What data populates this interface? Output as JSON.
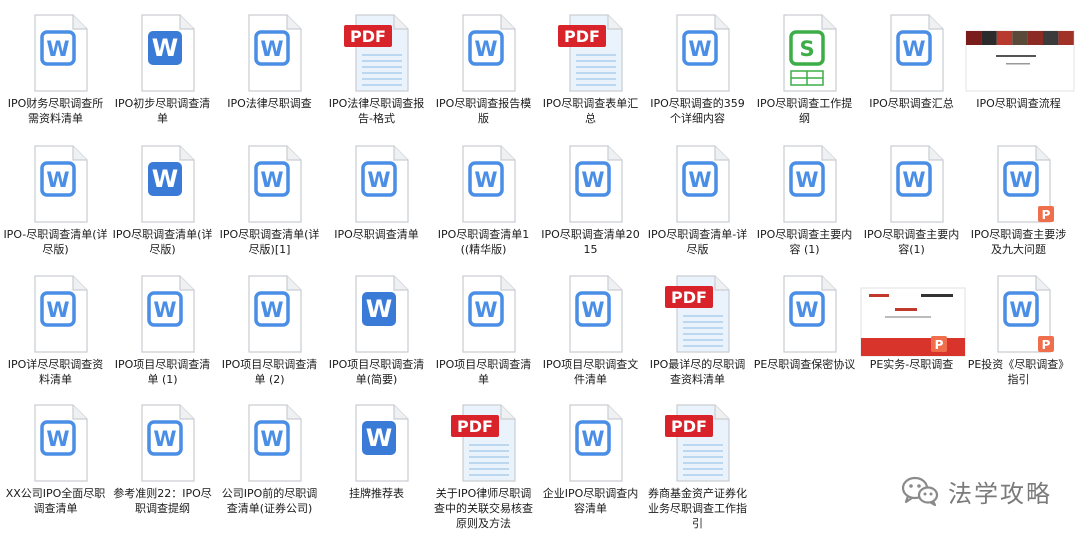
{
  "files": [
    {
      "name": "IPO财务尽职调查所需资料清单",
      "icon": "word-doc-icon"
    },
    {
      "name": "IPO初步尽职调查清单",
      "icon": "word-doc-icon"
    },
    {
      "name": "IPO法律尽职调查",
      "icon": "word-doc-icon"
    },
    {
      "name": "IPO法律尽职调查报告-格式",
      "icon": "pdf-doc-icon"
    },
    {
      "name": "IPO尽职调查报告模版",
      "icon": "word-doc-icon"
    },
    {
      "name": "IPO尽职调查表单汇总",
      "icon": "pdf-doc-icon"
    },
    {
      "name": "IPO尽职调查的359个详细内容",
      "icon": "word-doc-icon"
    },
    {
      "name": "IPO尽职调查工作提纲",
      "icon": "spreadsheet-doc-icon"
    },
    {
      "name": "IPO尽职调查汇总",
      "icon": "word-doc-icon"
    },
    {
      "name": "IPO尽职调查流程",
      "icon": "image-thumbnail-icon"
    },
    {
      "name": "IPO-尽职调查清单(详尽版)",
      "icon": "word-doc-icon"
    },
    {
      "name": "IPO尽职调查清单(详尽版)",
      "icon": "word-doc-icon"
    },
    {
      "name": "IPO尽职调查清单(详尽版)[1]",
      "icon": "word-doc-icon"
    },
    {
      "name": "IPO尽职调查清单",
      "icon": "word-doc-icon"
    },
    {
      "name": "IPO尽职调查清单1((精华版)",
      "icon": "word-doc-icon"
    },
    {
      "name": "IPO尽职调查清单2015",
      "icon": "word-doc-icon"
    },
    {
      "name": "IPO尽职调查清单-详尽版",
      "icon": "word-doc-icon"
    },
    {
      "name": "IPO尽职调查主要内容 (1)",
      "icon": "word-doc-icon"
    },
    {
      "name": "IPO尽职调查主要内容(1)",
      "icon": "word-doc-icon"
    },
    {
      "name": "IPO尽职调查主要涉及九大问题",
      "icon": "word-doc-icon",
      "badge": "P"
    },
    {
      "name": "IPO详尽尽职调查资料清单",
      "icon": "word-doc-icon"
    },
    {
      "name": "IPO项目尽职调查清单 (1)",
      "icon": "word-doc-icon"
    },
    {
      "name": "IPO项目尽职调查清单 (2)",
      "icon": "word-doc-icon"
    },
    {
      "name": "IPO项目尽职调查清单(简要)",
      "icon": "word-doc-icon"
    },
    {
      "name": "IPO项目尽职调查清单",
      "icon": "word-doc-icon"
    },
    {
      "name": "IPO项目尽职调查文件清单",
      "icon": "word-doc-icon"
    },
    {
      "name": "IPO最详尽的尽职调查资料清单",
      "icon": "pdf-doc-icon"
    },
    {
      "name": "PE尽职调查保密协议",
      "icon": "word-doc-icon"
    },
    {
      "name": "PE实务-尽职调查",
      "icon": "slides-thumbnail-icon",
      "badge": "P"
    },
    {
      "name": "PE投资《尽职调查》指引",
      "icon": "word-doc-icon",
      "badge": "P"
    },
    {
      "name": "XX公司IPO全面尽职调查清单",
      "icon": "word-doc-icon"
    },
    {
      "name": "参考准则22：IPO尽职调查提纲",
      "icon": "word-doc-icon"
    },
    {
      "name": "公司IPO前的尽职调查清单(证券公司)",
      "icon": "word-doc-icon"
    },
    {
      "name": "挂牌推荐表",
      "icon": "word-doc-icon"
    },
    {
      "name": "关于IPO律师尽职调查中的关联交易核查原则及方法",
      "icon": "pdf-doc-icon"
    },
    {
      "name": "企业IPO尽职调查内容清单",
      "icon": "word-doc-icon"
    },
    {
      "name": "券商基金资产证券化业务尽职调查工作指引",
      "icon": "pdf-doc-icon"
    }
  ],
  "icon_text": {
    "word": "W",
    "pdf": "PDF",
    "sheet": "S",
    "ppt": "P"
  },
  "watermark": {
    "text": "法学攻略",
    "icon": "wechat-icon"
  },
  "colors": {
    "word_blue": "#4a8ee6",
    "word_dark_blue": "#3b7bd8",
    "pdf_red": "#d8232a",
    "sheet_green": "#3dae47",
    "ppt_orange": "#ef6f4c",
    "label_text": "#1a1a1a",
    "watermark_gray": "#7a7a7a"
  }
}
